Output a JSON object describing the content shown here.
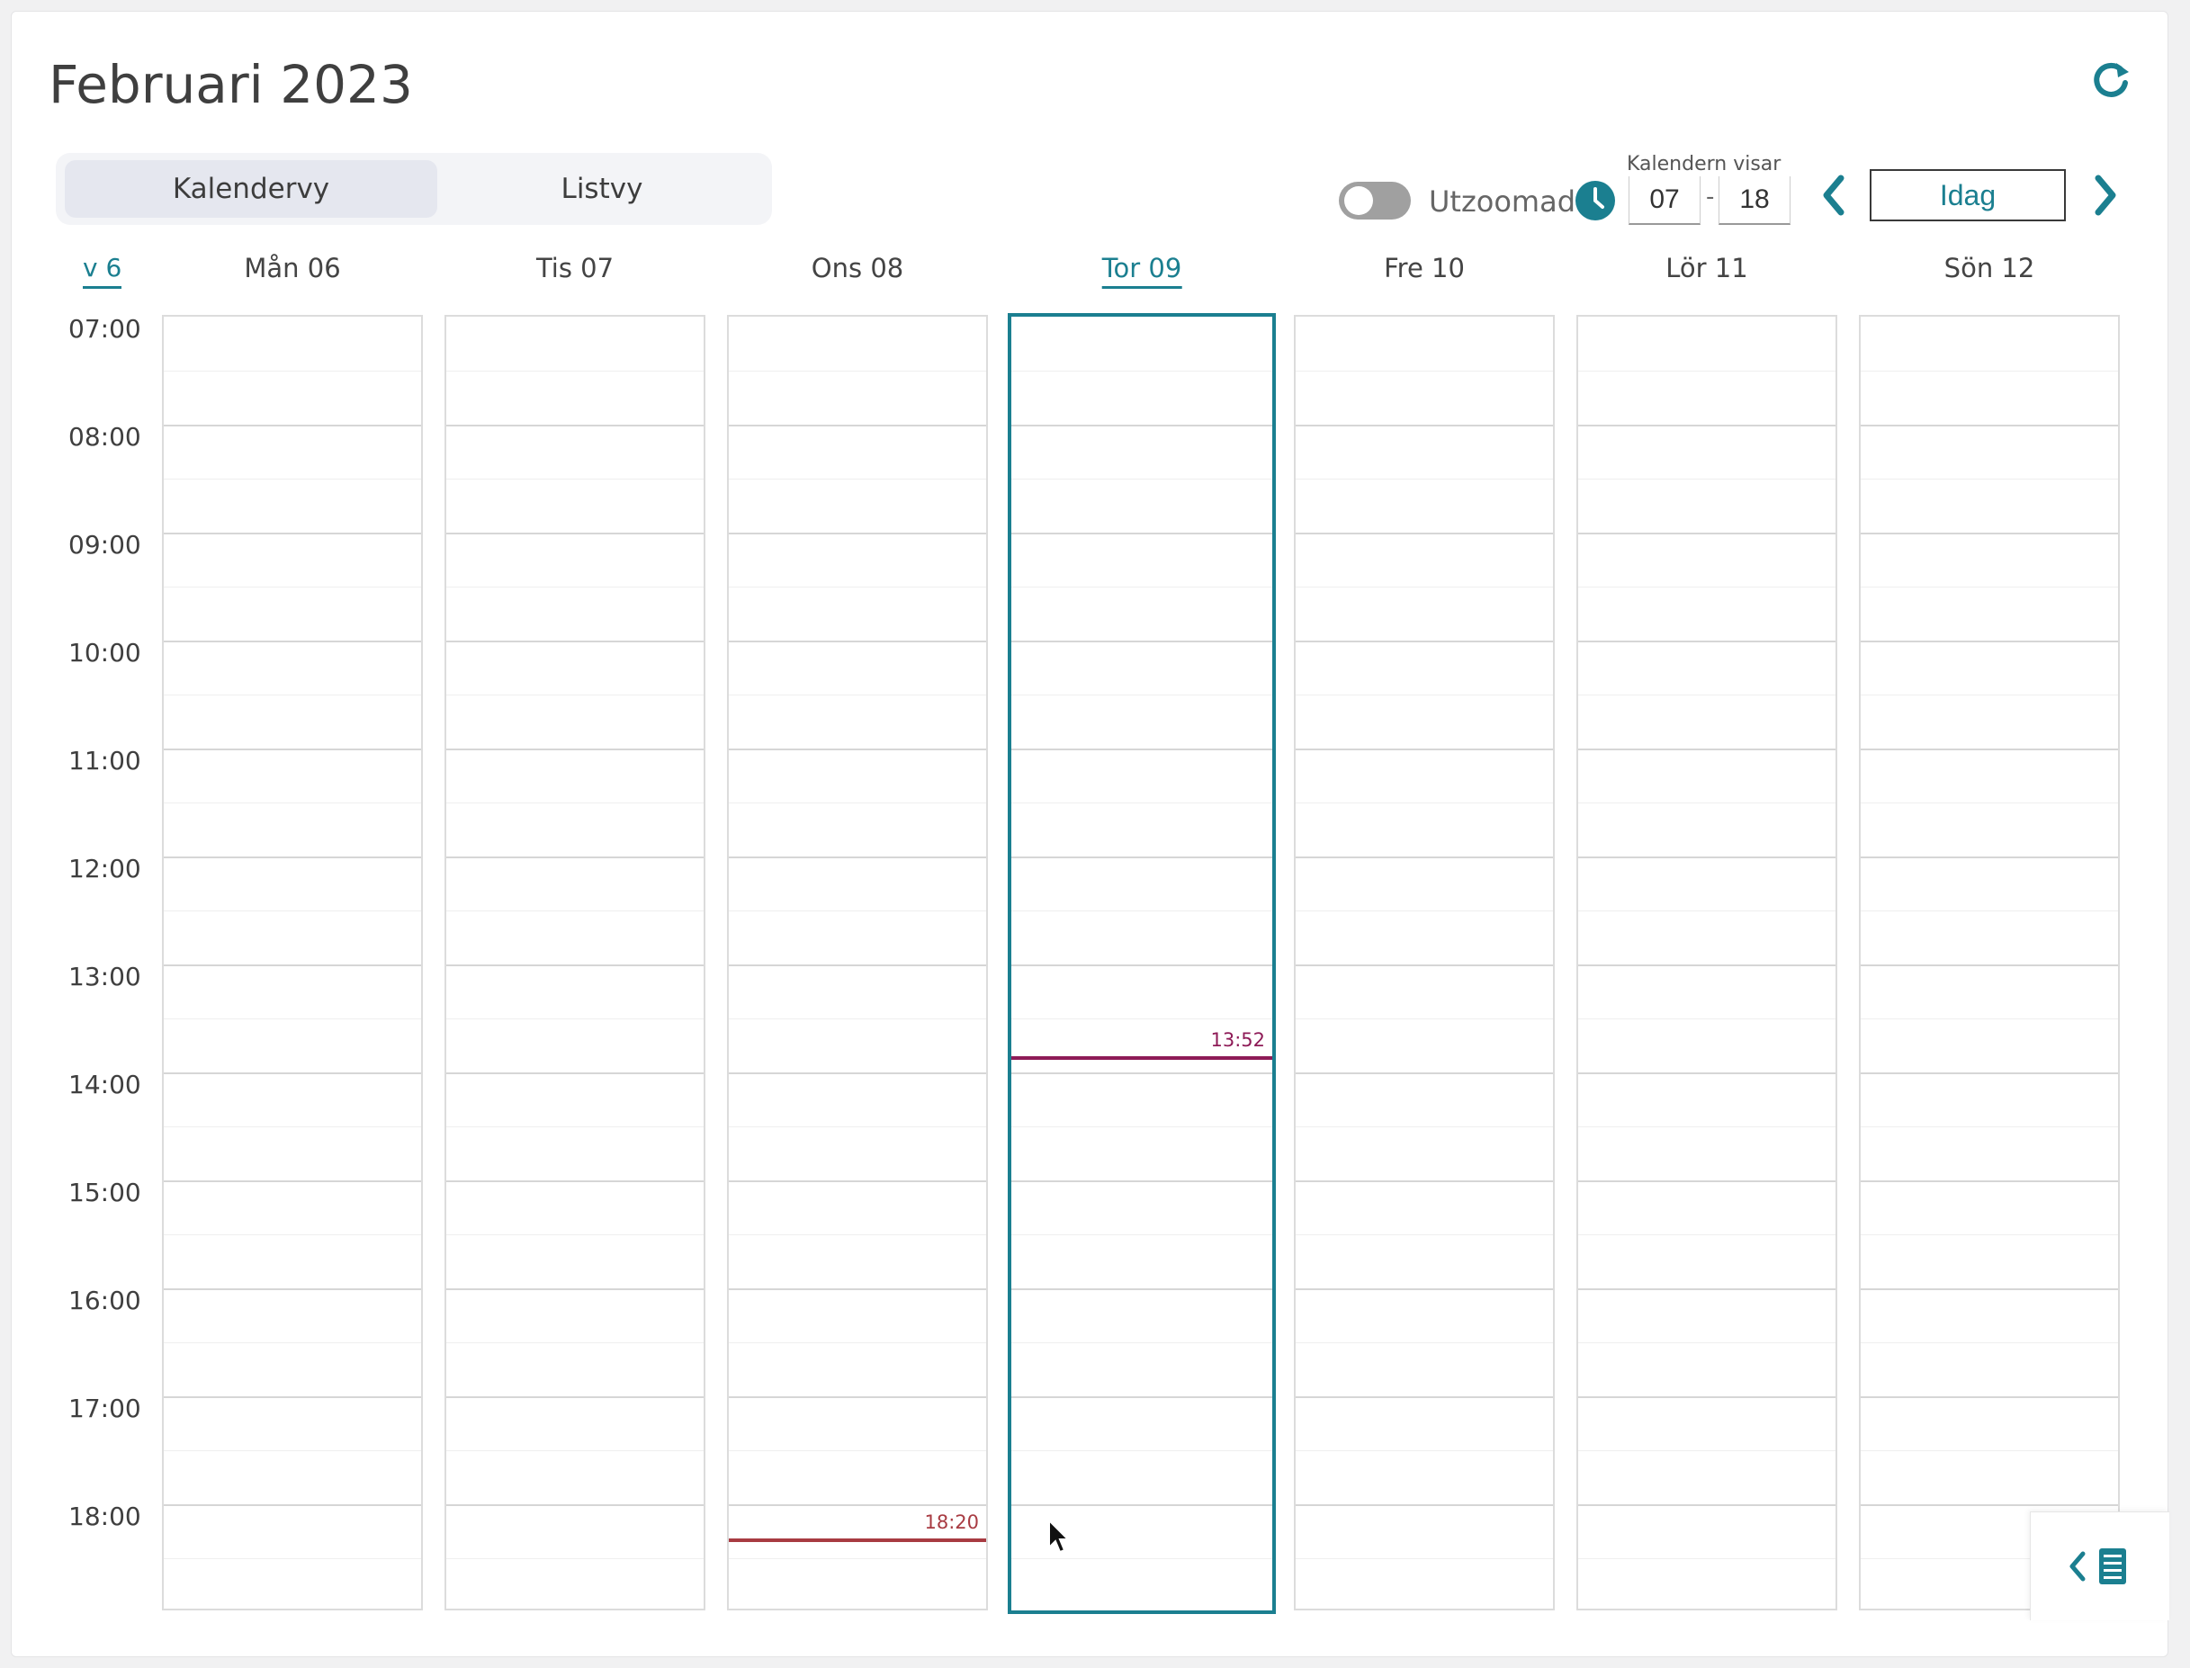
{
  "header": {
    "title": "Februari 2023"
  },
  "view_switch": {
    "calendar_label": "Kalendervy",
    "list_label": "Listvy",
    "active": "calendar"
  },
  "zoom": {
    "label": "Utzoomad",
    "on": false
  },
  "range": {
    "caption": "Kalendern visar",
    "start": "07",
    "end": "18",
    "separator": "-"
  },
  "nav": {
    "today_label": "Idag"
  },
  "week": {
    "label": "v 6"
  },
  "days": [
    {
      "label": "Mån 06",
      "today": false
    },
    {
      "label": "Tis 07",
      "today": false
    },
    {
      "label": "Ons 08",
      "today": false
    },
    {
      "label": "Tor 09",
      "today": true
    },
    {
      "label": "Fre 10",
      "today": false
    },
    {
      "label": "Lör 11",
      "today": false
    },
    {
      "label": "Sön 12",
      "today": false
    }
  ],
  "hours": [
    "07:00",
    "08:00",
    "09:00",
    "10:00",
    "11:00",
    "12:00",
    "13:00",
    "14:00",
    "15:00",
    "16:00",
    "17:00",
    "18:00"
  ],
  "markers": [
    {
      "day": 3,
      "time": "13:52",
      "color": "#8e1b57"
    },
    {
      "day": 2,
      "time": "18:20",
      "color": "#a83b42"
    }
  ],
  "colors": {
    "accent": "#1b7f90"
  }
}
